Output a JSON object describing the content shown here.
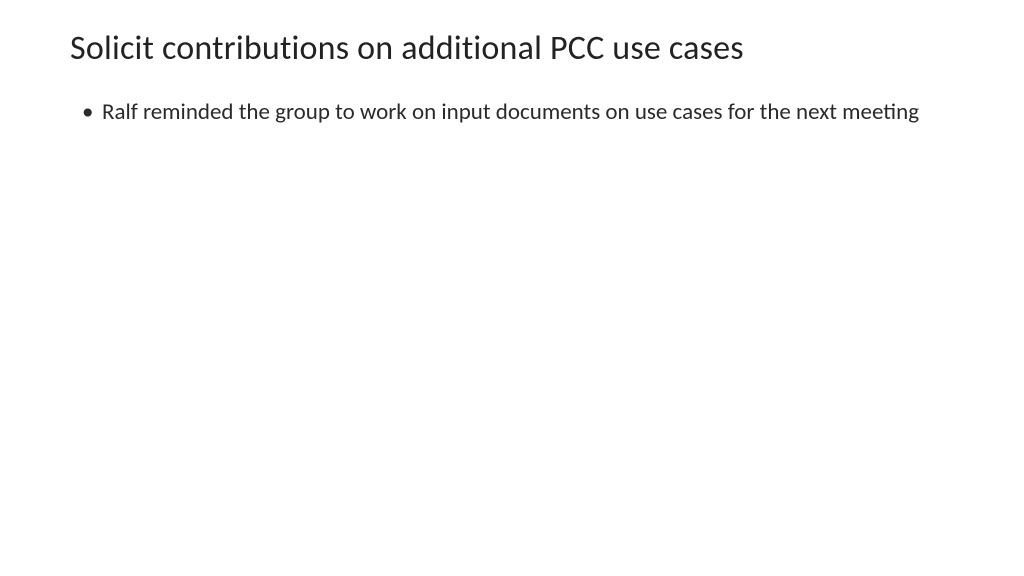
{
  "slide": {
    "title": "Solicit contributions on additional PCC use cases",
    "bullets": [
      "Ralf reminded the group to work on input documents on use cases for the next meeting"
    ]
  }
}
